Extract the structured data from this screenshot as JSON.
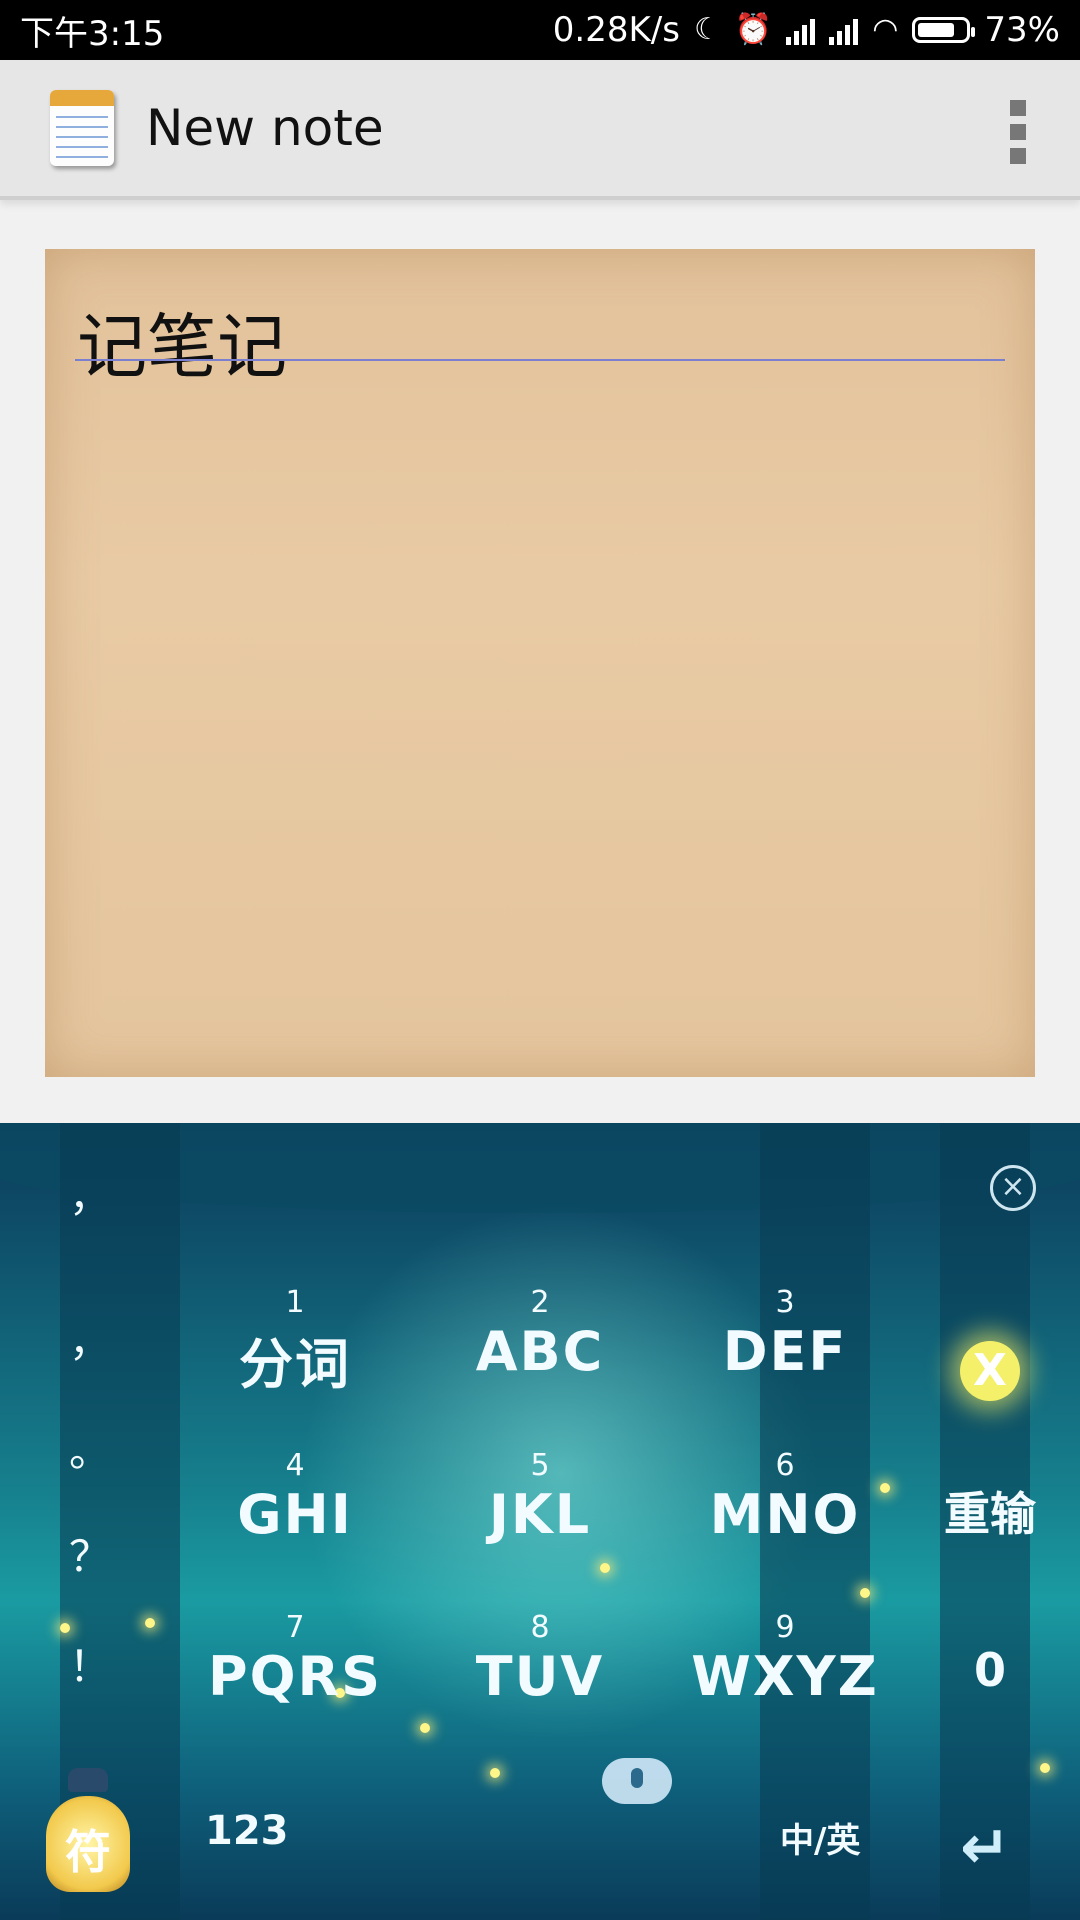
{
  "status_bar": {
    "time": "下午3:15",
    "net_speed": "0.28K/s",
    "moon_icon": "moon-icon",
    "alarm_icon": "alarm-icon",
    "battery": "73%",
    "battery_level": 0.73
  },
  "app_bar": {
    "title": "New note",
    "app_icon": "notepad-icon",
    "menu_icon": "overflow-menu-icon"
  },
  "note": {
    "title_text": "记笔记"
  },
  "keyboard": {
    "punctuation": [
      "，",
      "，",
      "。",
      "？",
      "！"
    ],
    "keys": [
      {
        "num": "1",
        "letters": "分词"
      },
      {
        "num": "2",
        "letters": "ABC"
      },
      {
        "num": "3",
        "letters": "DEF"
      },
      {
        "num": "4",
        "letters": "GHI"
      },
      {
        "num": "5",
        "letters": "JKL"
      },
      {
        "num": "6",
        "letters": "MNO"
      },
      {
        "num": "7",
        "letters": "PQRS"
      },
      {
        "num": "8",
        "letters": "TUV"
      },
      {
        "num": "9",
        "letters": "WXYZ"
      }
    ],
    "delete_label": "X",
    "reinput_label": "重输",
    "zero_label": "0",
    "symbol_label": "符",
    "numeric_label": "123",
    "lang_switch_label": "中/英",
    "enter_icon": "enter-arrow-icon",
    "close_icon": "close-keyboard-icon",
    "mic_icon": "microphone-icon"
  }
}
